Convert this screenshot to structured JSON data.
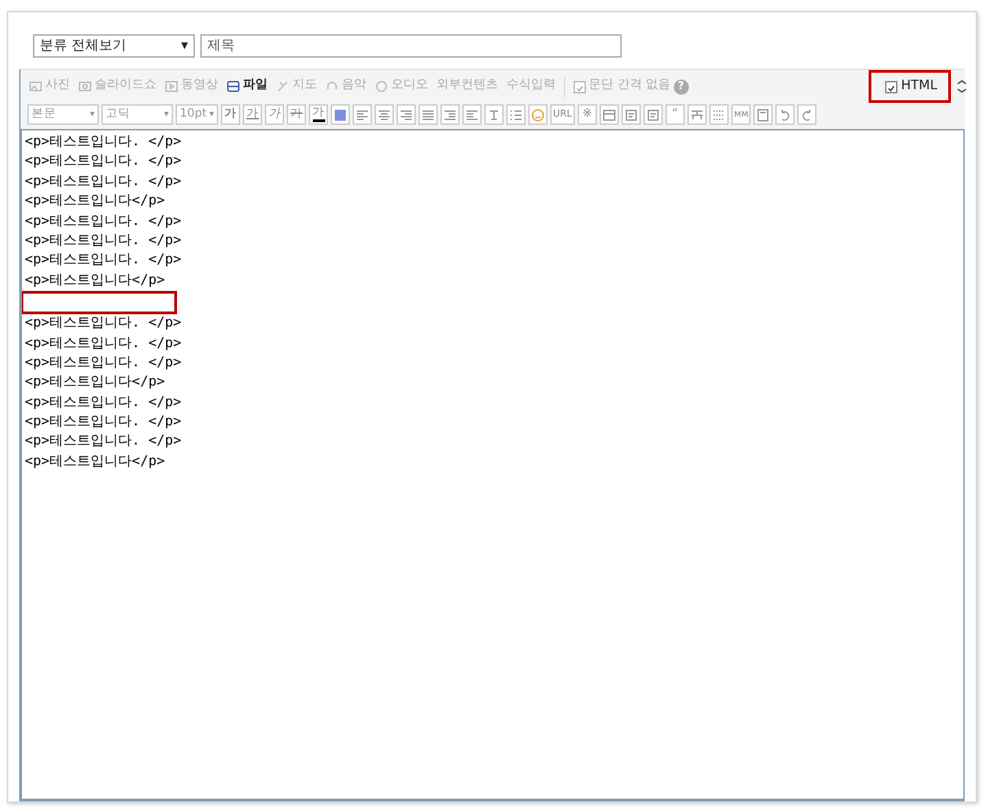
{
  "category_select": {
    "value": "분류 전체보기",
    "caret": "▾"
  },
  "title_field": {
    "placeholder": "제목"
  },
  "insert_toolbar": [
    {
      "label": "사진",
      "disabled": true
    },
    {
      "label": "슬라이드쇼",
      "disabled": true
    },
    {
      "label": "동영상",
      "disabled": true
    },
    {
      "label": "파일",
      "disabled": false
    },
    {
      "label": "지도",
      "disabled": true
    },
    {
      "label": "음악",
      "disabled": true
    },
    {
      "label": "오디오",
      "disabled": true
    },
    {
      "label": "외부컨텐츠",
      "disabled": true
    },
    {
      "label": "수식입력",
      "disabled": true
    }
  ],
  "paragraph_spacing": {
    "label": "문단 간격 없음",
    "checked": true,
    "disabled": true,
    "help": "?"
  },
  "html_toggle": {
    "label": "HTML",
    "checked": true,
    "highlighted": true
  },
  "format_toolbar": [
    {
      "kind": "select",
      "label": "본문",
      "caret": "▾"
    },
    {
      "kind": "select",
      "label": "고딕",
      "caret": "▾"
    },
    {
      "kind": "select",
      "label": "10pt",
      "caret": "▾"
    },
    {
      "kind": "glyph",
      "label": "가"
    },
    {
      "kind": "glyph",
      "label": "가"
    },
    {
      "kind": "glyph",
      "label": "가"
    },
    {
      "kind": "glyph",
      "label": "가"
    },
    {
      "kind": "glyph",
      "label": "가"
    },
    {
      "kind": "icon"
    },
    {
      "kind": "icon"
    },
    {
      "kind": "icon"
    },
    {
      "kind": "icon"
    },
    {
      "kind": "icon"
    },
    {
      "kind": "icon"
    },
    {
      "kind": "icon"
    },
    {
      "kind": "icon"
    },
    {
      "kind": "icon"
    },
    {
      "kind": "icon"
    },
    {
      "kind": "glyph",
      "label": "URL"
    },
    {
      "kind": "glyph",
      "label": "※"
    },
    {
      "kind": "icon"
    },
    {
      "kind": "icon"
    },
    {
      "kind": "icon"
    },
    {
      "kind": "glyph",
      "label": "“"
    },
    {
      "kind": "icon"
    },
    {
      "kind": "icon"
    },
    {
      "kind": "glyph",
      "label": "ᴍᴍ"
    },
    {
      "kind": "icon"
    },
    {
      "kind": "icon"
    },
    {
      "kind": "icon"
    }
  ],
  "editor_lines": [
    {
      "kind": "text",
      "text": "<p>테스트입니다. </p>"
    },
    {
      "kind": "text",
      "text": "<p>테스트입니다. </p>"
    },
    {
      "kind": "text",
      "text": "<p>테스트입니다. </p>"
    },
    {
      "kind": "text",
      "text": "<p>테스트입니다</p>"
    },
    {
      "kind": "text",
      "text": "<p>테스트입니다. </p>"
    },
    {
      "kind": "text",
      "text": "<p>테스트입니다. </p>"
    },
    {
      "kind": "text",
      "text": "<p>테스트입니다. </p>"
    },
    {
      "kind": "text",
      "text": "<p>테스트입니다</p>"
    },
    {
      "kind": "blank",
      "highlighted": true
    },
    {
      "kind": "text",
      "text": "<p>테스트입니다. </p>"
    },
    {
      "kind": "text",
      "text": "<p>테스트입니다. </p>"
    },
    {
      "kind": "text",
      "text": "<p>테스트입니다. </p>"
    },
    {
      "kind": "text",
      "text": "<p>테스트입니다</p>"
    },
    {
      "kind": "text",
      "text": "<p>테스트입니다. </p>"
    },
    {
      "kind": "text",
      "text": "<p>테스트입니다. </p>"
    },
    {
      "kind": "text",
      "text": "<p>테스트입니다. </p>"
    },
    {
      "kind": "text",
      "text": "<p>테스트입니다</p>"
    }
  ]
}
